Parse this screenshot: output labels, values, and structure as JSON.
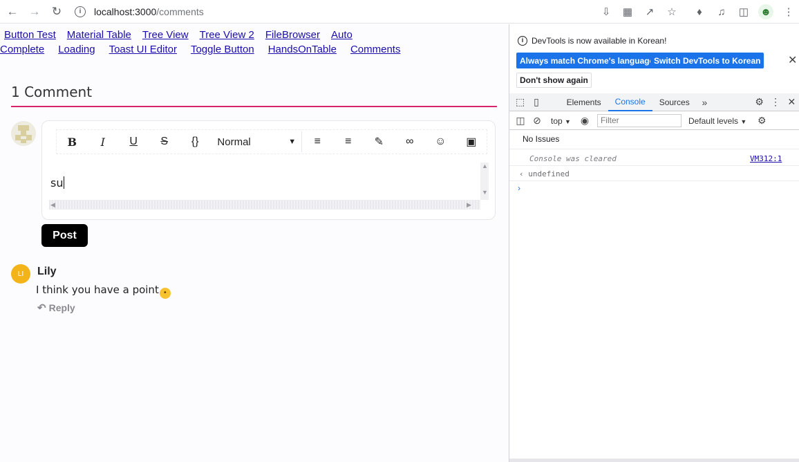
{
  "browser": {
    "url_host": "localhost:3000",
    "url_path": "/comments"
  },
  "nav": {
    "links": [
      "Button Test",
      "Material Table",
      "Tree View",
      "Tree View 2",
      "FileBrowser",
      "Auto",
      "Complete",
      "Loading",
      "Toast UI Editor",
      "Toggle Button",
      "HandsOnTable",
      "Comments"
    ]
  },
  "comments": {
    "title": "1 Comment",
    "editor": {
      "format_select": "Normal",
      "content": "su"
    },
    "post_label": "Post",
    "items": [
      {
        "avatar_initials": "LI",
        "name": "Lily",
        "text": "I think you have a point",
        "reply_label": "Reply"
      }
    ]
  },
  "devtools": {
    "notice": "DevTools is now available in Korean!",
    "btn_match": "Always match Chrome's language",
    "btn_switch": "Switch DevTools to Korean",
    "btn_dont_show": "Don't show again",
    "tabs": [
      "Elements",
      "Console",
      "Sources"
    ],
    "active_tab": "Console",
    "context": "top",
    "filter_placeholder": "Filter",
    "levels": "Default levels",
    "no_issues": "No Issues",
    "console": {
      "cleared": "Console was cleared",
      "location": "VM312:1",
      "return_value": "undefined"
    }
  },
  "colors": {
    "accent_line": "#d6246e",
    "devtools_blue": "#1a73e8",
    "avatar_lily": "#f3b41a"
  }
}
